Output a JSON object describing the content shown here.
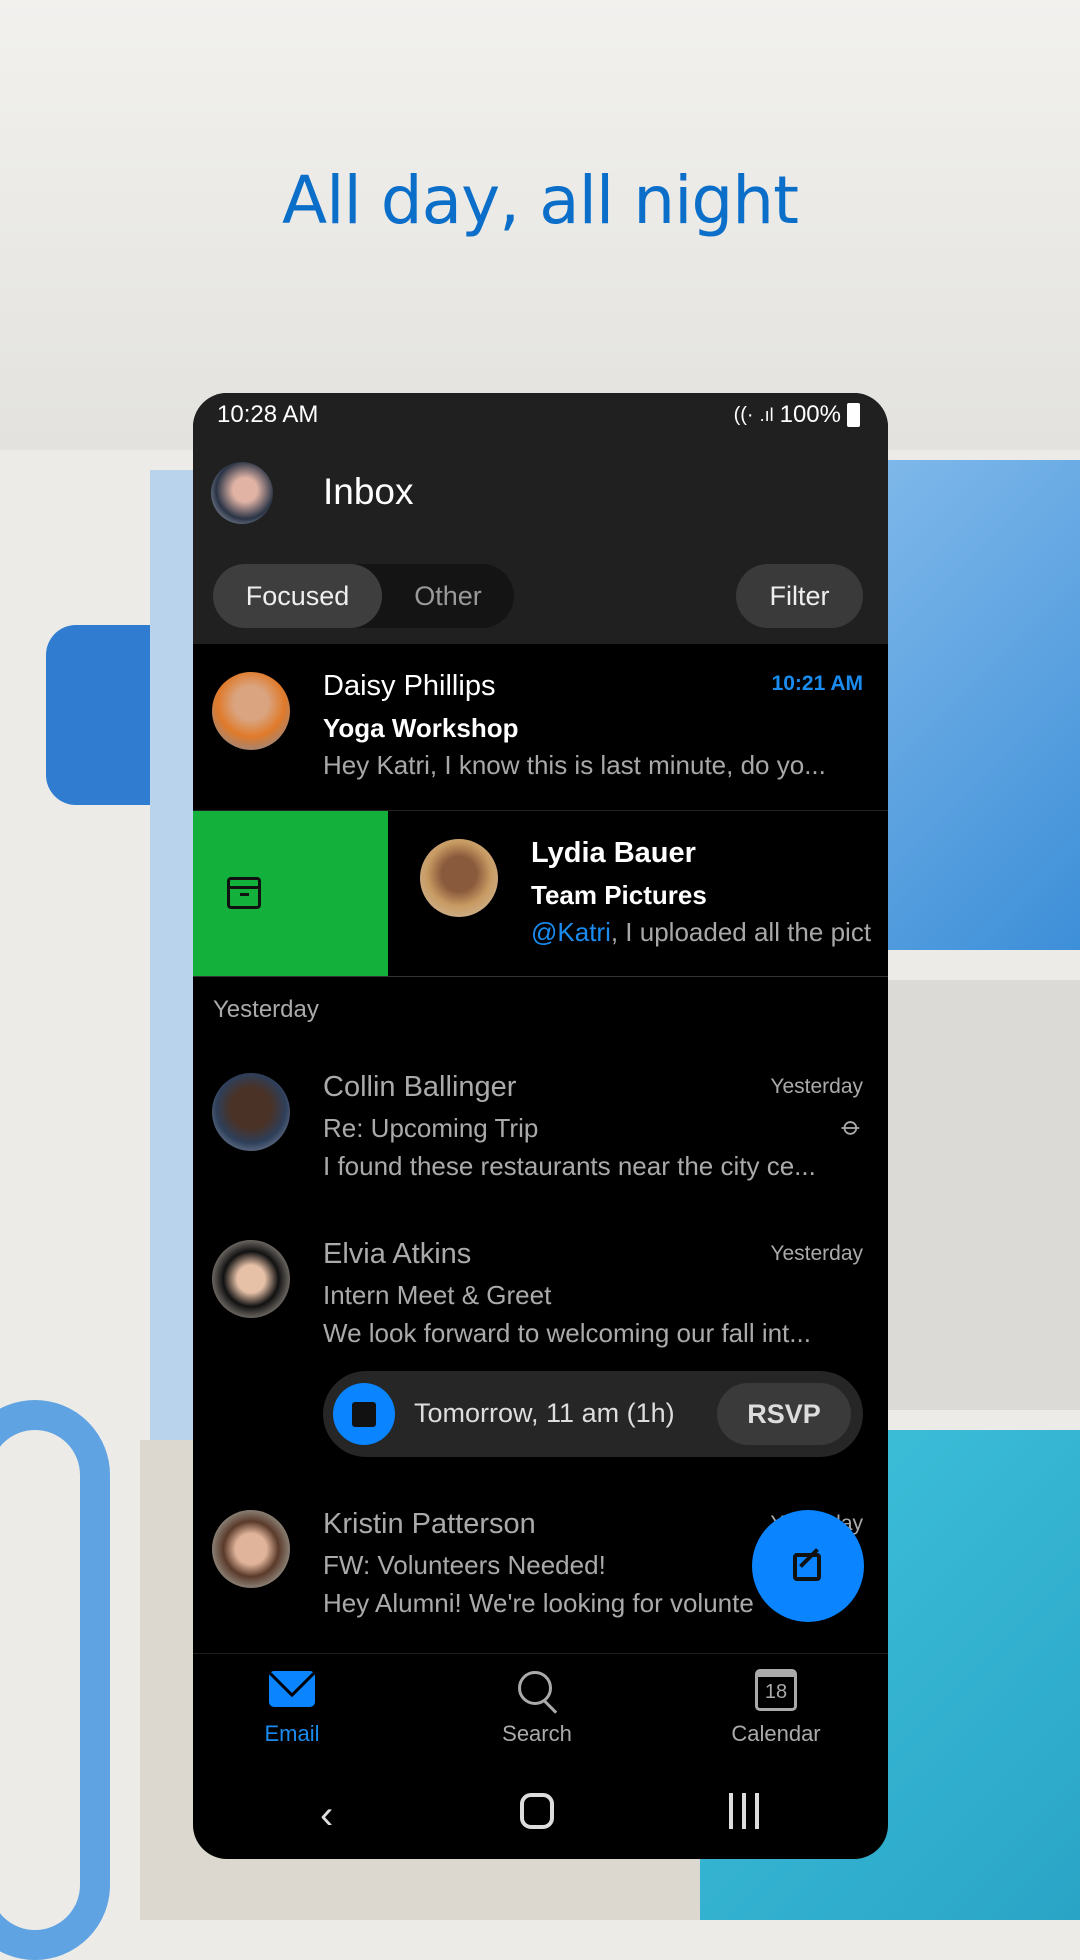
{
  "headline": "All day, all night",
  "status": {
    "time": "10:28 AM",
    "battery": "100%"
  },
  "header": {
    "title": "Inbox",
    "tabs": [
      {
        "label": "Focused",
        "active": true
      },
      {
        "label": "Other",
        "active": false
      }
    ],
    "filter_label": "Filter"
  },
  "accent": "#0a84ff",
  "swipe_action": {
    "icon": "archive-icon",
    "color": "#13b03c"
  },
  "emails": [
    {
      "sender": "Daisy Phillips",
      "subject": "Yoga Workshop",
      "preview": "Hey Katri, I know this is last minute, do yo...",
      "time": "10:21 AM",
      "unread": true
    },
    {
      "sender": "Lydia Bauer",
      "subject": "Team Pictures",
      "mention": "@Katri",
      "preview": ", I uploaded all the pict",
      "unread": true
    },
    {
      "sender": "Collin Ballinger",
      "subject": "Re: Upcoming Trip",
      "preview": "I found these restaurants near the city ce...",
      "time": "Yesterday",
      "attachment": true
    },
    {
      "sender": "Elvia Atkins",
      "subject": "Intern Meet & Greet",
      "preview": "We look forward to welcoming our fall int...",
      "time": "Yesterday",
      "event": {
        "when": "Tomorrow, 11 am (1h)",
        "rsvp_label": "RSVP"
      }
    },
    {
      "sender": "Kristin Patterson",
      "subject": "FW: Volunteers Needed!",
      "preview": "Hey Alumni! We're looking for volunte",
      "time": "Yesterday"
    }
  ],
  "section_header": "Yesterday",
  "bottom_nav": [
    {
      "label": "Email",
      "icon": "mail-icon",
      "active": true
    },
    {
      "label": "Search",
      "icon": "search-icon"
    },
    {
      "label": "Calendar",
      "icon": "calendar-icon",
      "date": "18"
    }
  ]
}
